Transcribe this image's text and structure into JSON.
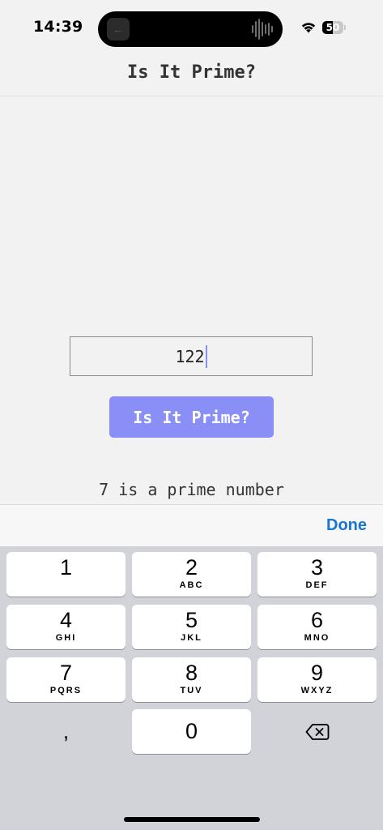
{
  "status_bar": {
    "time": "14:39",
    "battery_level": "50",
    "battery_fraction": 0.5
  },
  "nav": {
    "title": "Is It Prime?"
  },
  "main": {
    "input_value": "122",
    "button_label": "Is It Prime?",
    "result_text": "7 is a prime number"
  },
  "accessory": {
    "done_label": "Done"
  },
  "keyboard": {
    "keys": [
      {
        "digit": "1",
        "letters": ""
      },
      {
        "digit": "2",
        "letters": "ABC"
      },
      {
        "digit": "3",
        "letters": "DEF"
      },
      {
        "digit": "4",
        "letters": "GHI"
      },
      {
        "digit": "5",
        "letters": "JKL"
      },
      {
        "digit": "6",
        "letters": "MNO"
      },
      {
        "digit": "7",
        "letters": "PQRS"
      },
      {
        "digit": "8",
        "letters": "TUV"
      },
      {
        "digit": "9",
        "letters": "WXYZ"
      },
      {
        "digit": "0",
        "letters": ""
      }
    ],
    "comma_label": ",",
    "delete_icon": "delete-backspace-icon"
  },
  "colors": {
    "accent": "#8a8ff8",
    "link": "#1976d2",
    "keyboard_bg": "#d1d3d9"
  }
}
